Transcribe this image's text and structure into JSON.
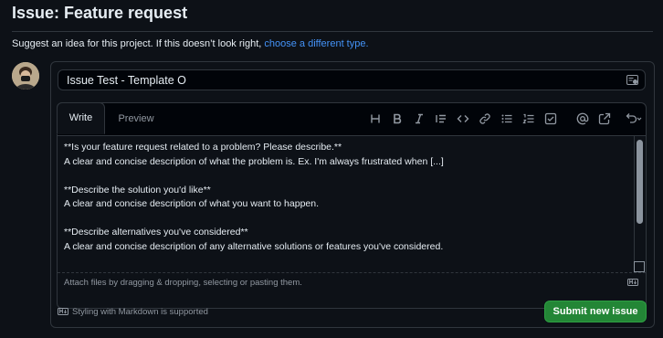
{
  "header": {
    "title": "Issue: Feature request",
    "subtitle_text": "Suggest an idea for this project. If this doesn’t look right, ",
    "subtitle_link": "choose a different type."
  },
  "form": {
    "title_value": "Issue Test - Template O",
    "tabs": [
      {
        "label": "Write",
        "active": true
      },
      {
        "label": "Preview",
        "active": false
      }
    ],
    "toolbar_icons": [
      "heading-icon",
      "bold-icon",
      "italic-icon",
      "quote-icon",
      "code-icon",
      "link-icon",
      "unordered-list-icon",
      "ordered-list-icon",
      "task-list-icon",
      "mention-icon",
      "reference-icon",
      "undo-icon"
    ],
    "body_text": "**Is your feature request related to a problem? Please describe.**\nA clear and concise description of what the problem is. Ex. I'm always frustrated when [...]\n\n**Describe the solution you'd like**\nA clear and concise description of what you want to happen.\n\n**Describe alternatives you've considered**\nA clear and concise description of any alternative solutions or features you've considered.",
    "attach_text": "Attach files by dragging & dropping, selecting or pasting them.",
    "markdown_hint": "Styling with Markdown is supported",
    "submit_label": "Submit new issue"
  },
  "colors": {
    "background": "#0d1117",
    "accent_link": "#4493f8",
    "submit_green": "#238636",
    "border": "#30363d"
  }
}
